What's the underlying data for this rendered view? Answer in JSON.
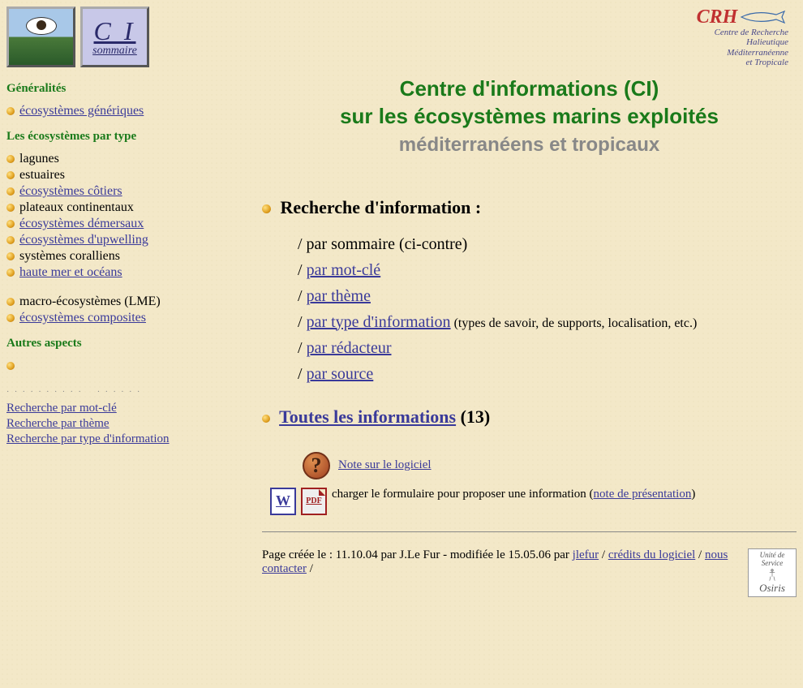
{
  "topIcons": {
    "ci_big": "C I",
    "ci_small": "sommaire"
  },
  "crh": {
    "acronym": "CRH",
    "line1": "Centre de Recherche",
    "line2": "Halieutique",
    "line3": "Méditerranéenne",
    "line4": "et Tropicale"
  },
  "sidebar": {
    "s1_head": "Généralités",
    "s1": [
      {
        "label": "écosystèmes génériques",
        "link": true
      }
    ],
    "s2_head": "Les écosystèmes par type",
    "s2a": [
      {
        "label": "lagunes",
        "link": false
      },
      {
        "label": "estuaires",
        "link": false
      },
      {
        "label": "écosystèmes côtiers",
        "link": true
      },
      {
        "label": "plateaux continentaux",
        "link": false
      },
      {
        "label": "écosystèmes démersaux",
        "link": true
      },
      {
        "label": "écosystèmes d'upwelling",
        "link": true
      },
      {
        "label": "systèmes coralliens",
        "link": false
      },
      {
        "label": "haute mer et océans",
        "link": true
      }
    ],
    "s2b": [
      {
        "label": "macro-écosystèmes (LME)",
        "link": false
      },
      {
        "label": "écosystèmes composites",
        "link": true
      }
    ],
    "s3_head": "Autres aspects",
    "searchLinks": [
      "Recherche par mot-clé",
      "Recherche par thème",
      "Recherche par type d'information"
    ]
  },
  "main": {
    "title1": "Centre d'informations (CI)",
    "title2": "sur les écosystèmes marins exploités",
    "title3": "méditerranéens et tropicaux",
    "search_header": "Recherche d'information :",
    "opt_sommaire_pre": "/ par sommaire (ci-contre)",
    "opt_motcle": "par mot-clé",
    "opt_theme": "par thème",
    "opt_type": "par type d'information",
    "opt_type_note": "  (types de savoir, de supports, localisation, etc.)",
    "opt_redacteur": "par rédacteur",
    "opt_source": "par source",
    "all_info": "Toutes les informations",
    "all_info_count": " (13)",
    "note_logiciel": "Note sur le logiciel",
    "form_text_a": "charger le formulaire pour proposer une information (",
    "form_link": "note de présentation",
    "form_text_b": ")",
    "footer_a": "Page créée le : 11.10.04 par J.Le Fur - modifiée le 15.05.06 par ",
    "footer_jlefur": "jlefur",
    "footer_sep": " / ",
    "footer_credits": "crédits du logiciel",
    "footer_contact": "nous contacter",
    "footer_end": " /",
    "osiris_top": "Unité de Service",
    "osiris_name": "Osiris"
  }
}
